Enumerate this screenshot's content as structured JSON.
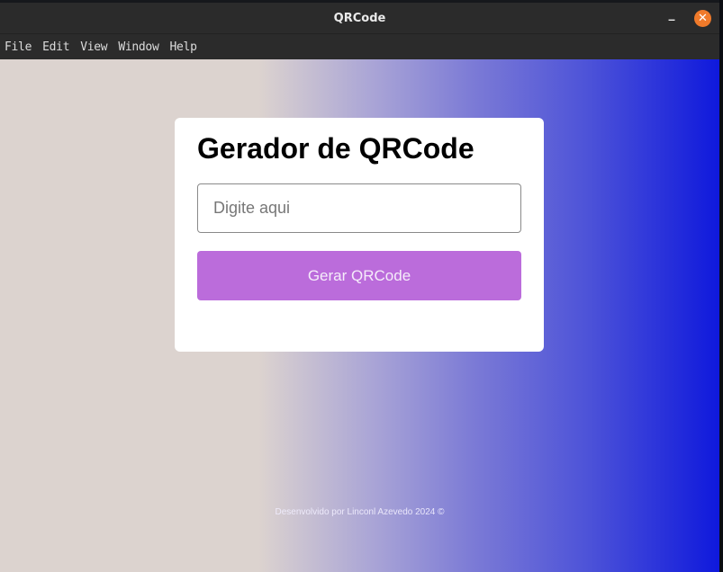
{
  "window": {
    "title": "QRCode",
    "minimize_glyph": "–",
    "close_glyph": "✕",
    "close_color": "#f07a2a"
  },
  "menu": {
    "items": [
      {
        "label": "File"
      },
      {
        "label": "Edit"
      },
      {
        "label": "View"
      },
      {
        "label": "Window"
      },
      {
        "label": "Help"
      }
    ]
  },
  "card": {
    "title": "Gerador de QRCode",
    "input_placeholder": "Digite aqui",
    "input_value": "",
    "button_label": "Gerar QRCode",
    "button_color": "#bb6cdb"
  },
  "footer": {
    "text": "Desenvolvido por Linconl Azevedo 2024 ©"
  }
}
